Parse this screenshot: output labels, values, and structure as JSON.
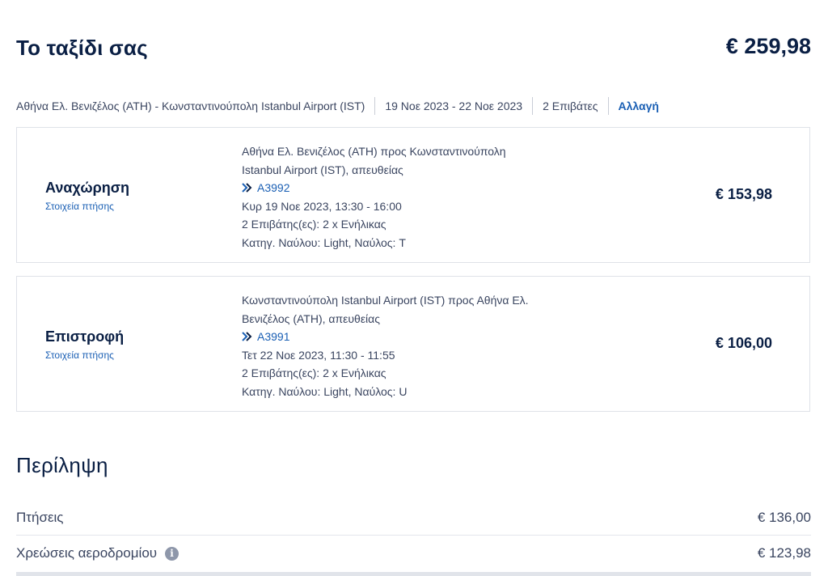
{
  "trip": {
    "title": "Το ταξίδι σας",
    "total": "€ 259,98"
  },
  "route_bar": {
    "route": "Αθήνα Ελ. Βενιζέλος (ATH) - Κωνσταντινούπολη Istanbul Airport (IST)",
    "dates": "19 Νοε 2023 - 22 Νοε 2023",
    "passengers": "2 Επιβάτες",
    "change_label": "Αλλαγή"
  },
  "outbound": {
    "leg_label": "Αναχώρηση",
    "details_link": "Στοιχεία πτήσης",
    "route_line1": "Αθήνα Ελ. Βενιζέλος (ATH) προς Κωνσταντινούπολη",
    "route_line2": "Istanbul Airport (IST), απευθείας",
    "flight_number": "A3992",
    "datetime": "Κυρ 19 Νοε 2023, 13:30 - 16:00",
    "passengers": "2 Επιβάτης(ες): 2 x Ενήλικας",
    "fare": "Κατηγ. Ναύλου: Light, Ναύλος: T",
    "price": "€ 153,98"
  },
  "return": {
    "leg_label": "Επιστροφή",
    "details_link": "Στοιχεία πτήσης",
    "route_line1": "Κωνσταντινούπολη Istanbul Airport (IST) προς Αθήνα Ελ.",
    "route_line2": "Βενιζέλος (ATH), απευθείας",
    "flight_number": "A3991",
    "datetime": "Τετ 22 Νοε 2023, 11:30 - 11:55",
    "passengers": "2 Επιβάτης(ες): 2 x Ενήλικας",
    "fare": "Κατηγ. Ναύλου: Light, Ναύλος: U",
    "price": "€ 106,00"
  },
  "summary": {
    "title": "Περίληψη",
    "flights_label": "Πτήσεις",
    "flights_amount": "€ 136,00",
    "fees_label": "Χρεώσεις αεροδρομίου",
    "fees_amount": "€ 123,98",
    "info_glyph": "i"
  },
  "icons": {
    "flight_number_icon": "airline-chevron-icon",
    "info_icon": "info-icon"
  },
  "colors": {
    "primary_text": "#0a1f44",
    "link": "#1a5fb4",
    "border": "#dfe2e8"
  }
}
